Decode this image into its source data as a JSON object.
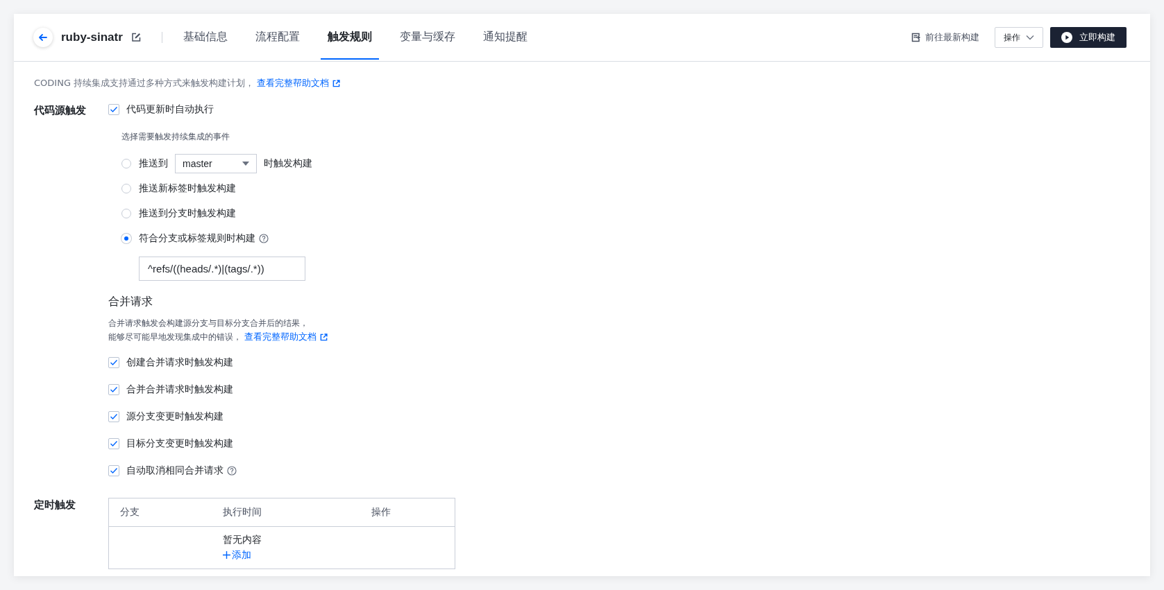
{
  "header": {
    "project_name": "ruby-sinatr",
    "tabs": [
      {
        "label": "基础信息",
        "selected": false
      },
      {
        "label": "流程配置",
        "selected": false
      },
      {
        "label": "触发规则",
        "selected": true
      },
      {
        "label": "变量与缓存",
        "selected": false
      },
      {
        "label": "通知提醒",
        "selected": false
      }
    ],
    "latest_build_link": "前往最新构建",
    "actions_button": "操作",
    "build_button": "立即构建"
  },
  "intro": {
    "text": "CODING 持续集成支持通过多种方式来触发构建计划，",
    "link": "查看完整帮助文档"
  },
  "code_trigger": {
    "label": "代码源触发",
    "auto_run": {
      "label": "代码更新时自动执行",
      "checked": true
    },
    "hint": "选择需要触发持续集成的事件",
    "options": [
      {
        "kind": "branch",
        "prefix": "推送到",
        "branch": "master",
        "suffix": "时触发构建",
        "selected": false,
        "help": false
      },
      {
        "kind": "plain",
        "label": "推送新标签时触发构建",
        "selected": false,
        "help": false
      },
      {
        "kind": "plain",
        "label": "推送到分支时触发构建",
        "selected": false,
        "help": false
      },
      {
        "kind": "plain",
        "label": "符合分支或标签规则时构建",
        "selected": true,
        "help": true
      }
    ],
    "rule_value": "^refs/((heads/.*)|(tags/.*))"
  },
  "merge_request": {
    "title": "合并请求",
    "desc_lines": [
      "合并请求触发会构建源分支与目标分支合并后的结果，",
      "能够尽可能早地发现集成中的错误，"
    ],
    "link": "查看完整帮助文档",
    "options": [
      {
        "label": "创建合并请求时触发构建",
        "checked": true,
        "help": false
      },
      {
        "label": "合并合并请求时触发构建",
        "checked": true,
        "help": false
      },
      {
        "label": "源分支变更时触发构建",
        "checked": true,
        "help": false
      },
      {
        "label": "目标分支变更时触发构建",
        "checked": true,
        "help": false
      },
      {
        "label": "自动取消相同合并请求",
        "checked": true,
        "help": true
      }
    ]
  },
  "schedule": {
    "label": "定时触发",
    "table": {
      "columns": [
        "分支",
        "执行时间",
        "操作"
      ],
      "empty_text": "暂无内容",
      "add_link": "添加"
    }
  }
}
